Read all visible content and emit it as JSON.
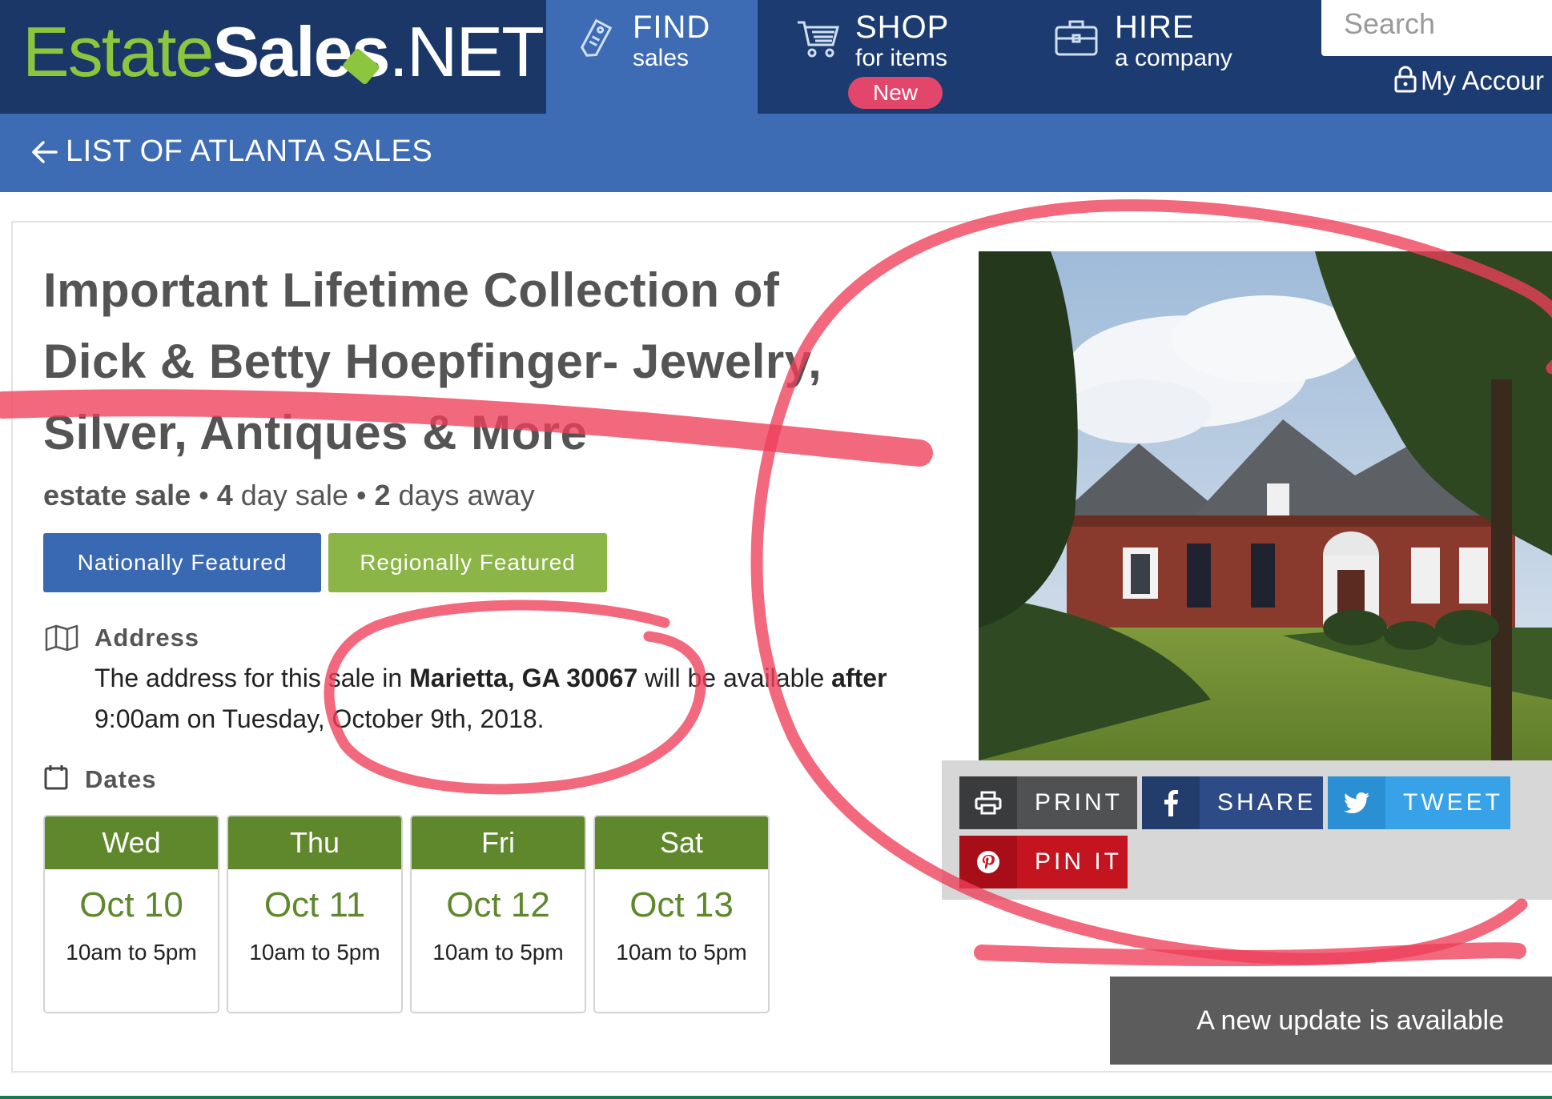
{
  "header": {
    "logo": {
      "part1": "Estate",
      "part2": "Sales",
      "part3": ".NET"
    },
    "nav": {
      "find": {
        "main": "FIND",
        "sub": "sales"
      },
      "shop": {
        "main": "SHOP",
        "sub": "for items",
        "badge": "New"
      },
      "hire": {
        "main": "HIRE",
        "sub": "a company"
      }
    },
    "search": {
      "placeholder": "Search"
    },
    "account": {
      "label": "My Accour"
    }
  },
  "subnav": {
    "back_label": "LIST OF ATLANTA SALES"
  },
  "sale": {
    "title": "Important Lifetime Collection of Dick & Betty Hoepfinger- Jewelry, Silver, Antiques & More",
    "type": "estate sale",
    "dot": "•",
    "duration": "4 day sale",
    "countdown": "2 days away",
    "badges": {
      "national": "Nationally Featured",
      "regional": "Regionally Featured"
    },
    "address": {
      "heading": "Address",
      "text_before": "The address for this sale in ",
      "location": "Marietta, GA 30067",
      "text_mid": " will be available ",
      "after": "after",
      "text_after": " 9:00am on Tuesday, October 9th, 2018."
    },
    "dates": {
      "heading": "Dates",
      "days": [
        {
          "day": "Wed",
          "date": "Oct 10",
          "time": "10am to 5pm"
        },
        {
          "day": "Thu",
          "date": "Oct 11",
          "time": "10am to 5pm"
        },
        {
          "day": "Fri",
          "date": "Oct 12",
          "time": "10am to 5pm"
        },
        {
          "day": "Sat",
          "date": "Oct 13",
          "time": "10am to 5pm"
        }
      ]
    }
  },
  "share": {
    "print": "PRINT",
    "share": "SHARE",
    "tweet": "TWEET",
    "pin": "PIN IT"
  },
  "toast": {
    "message": "A new update is available"
  },
  "colors": {
    "header_navy": "#1c3b70",
    "header_blue": "#3d6bb4",
    "brand_green": "#8cc63f",
    "dates_green": "#5e882b",
    "badge_pink": "#e2466b",
    "annotation_red": "#ee3f5a"
  }
}
